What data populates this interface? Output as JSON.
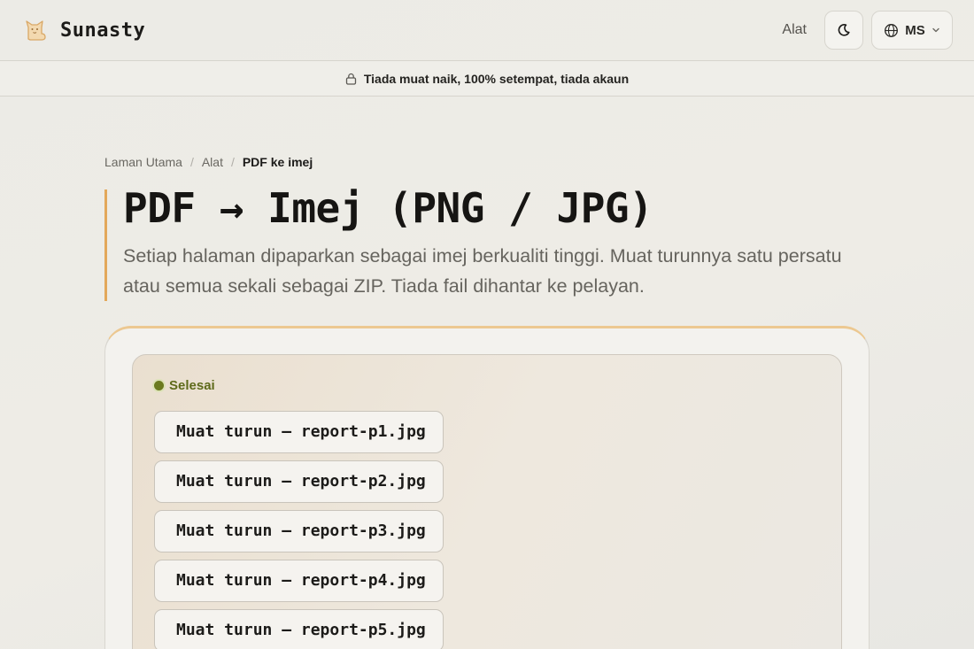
{
  "header": {
    "brand": "Sunasty",
    "nav_tools": "Alat",
    "lang": "MS"
  },
  "banner": {
    "text": "Tiada muat naik, 100% setempat, tiada akaun"
  },
  "breadcrumb": {
    "home": "Laman Utama",
    "tools": "Alat",
    "current": "PDF ke imej"
  },
  "hero": {
    "title": "PDF → Imej (PNG / JPG)",
    "subtitle": "Setiap halaman dipaparkan sebagai imej berkualiti tinggi. Muat turunnya satu persatu atau semua sekali sebagai ZIP. Tiada fail dihantar ke pelayan."
  },
  "result": {
    "status": "Selesai",
    "downloads": [
      "Muat turun — report-p1.jpg",
      "Muat turun — report-p2.jpg",
      "Muat turun — report-p3.jpg",
      "Muat turun — report-p4.jpg",
      "Muat turun — report-p5.jpg"
    ]
  },
  "colors": {
    "accent": "#e3a85a",
    "status_green": "#6b7a1f"
  },
  "icons": {
    "logo": "cat-logo-icon",
    "theme": "moon-icon",
    "lang": "globe-icon",
    "lang_chevron": "chevron-down-icon",
    "banner": "lock-icon"
  }
}
